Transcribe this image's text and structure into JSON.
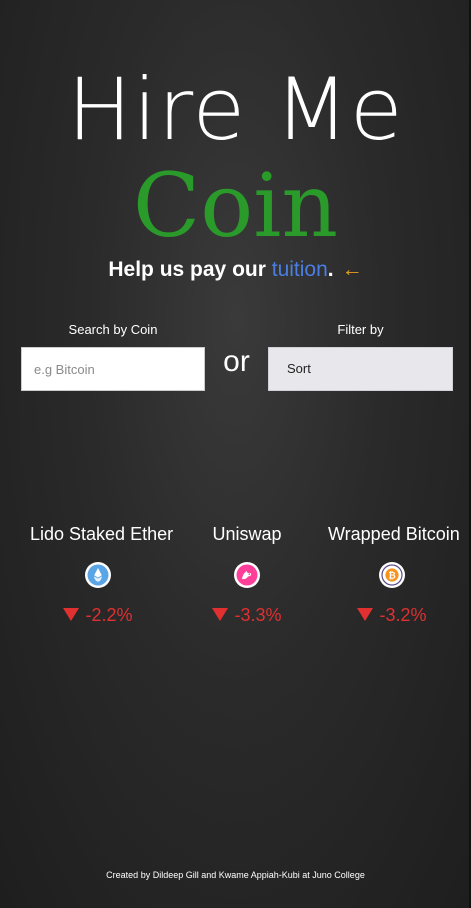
{
  "header": {
    "title_line1": "Hire Me",
    "title_line2": "Coin",
    "tagline_prefix": "Help us pay our ",
    "tagline_accent": "tuition",
    "tagline_suffix": ".",
    "tagline_arrow": "←"
  },
  "search": {
    "label": "Search by Coin",
    "placeholder": "e.g Bitcoin",
    "value": ""
  },
  "divider_text": "or",
  "filter": {
    "label": "Filter by",
    "selected": "Sort"
  },
  "coins": [
    {
      "name": "Lido Staked Ether",
      "icon": "lido-staked-ether-icon",
      "change": "-2.2%",
      "direction": "down"
    },
    {
      "name": "Uniswap",
      "icon": "uniswap-icon",
      "change": "-3.3%",
      "direction": "down"
    },
    {
      "name": "Wrapped Bitcoin",
      "icon": "wrapped-bitcoin-icon",
      "change": "-3.2%",
      "direction": "down"
    }
  ],
  "colors": {
    "brand_green": "#2a9a2a",
    "accent_blue": "#4a7ee0",
    "arrow_orange": "#e8a21c",
    "negative_red": "#e03030"
  },
  "footer": {
    "credit": "Created by Dildeep Gill and Kwame Appiah-Kubi at Juno College"
  }
}
